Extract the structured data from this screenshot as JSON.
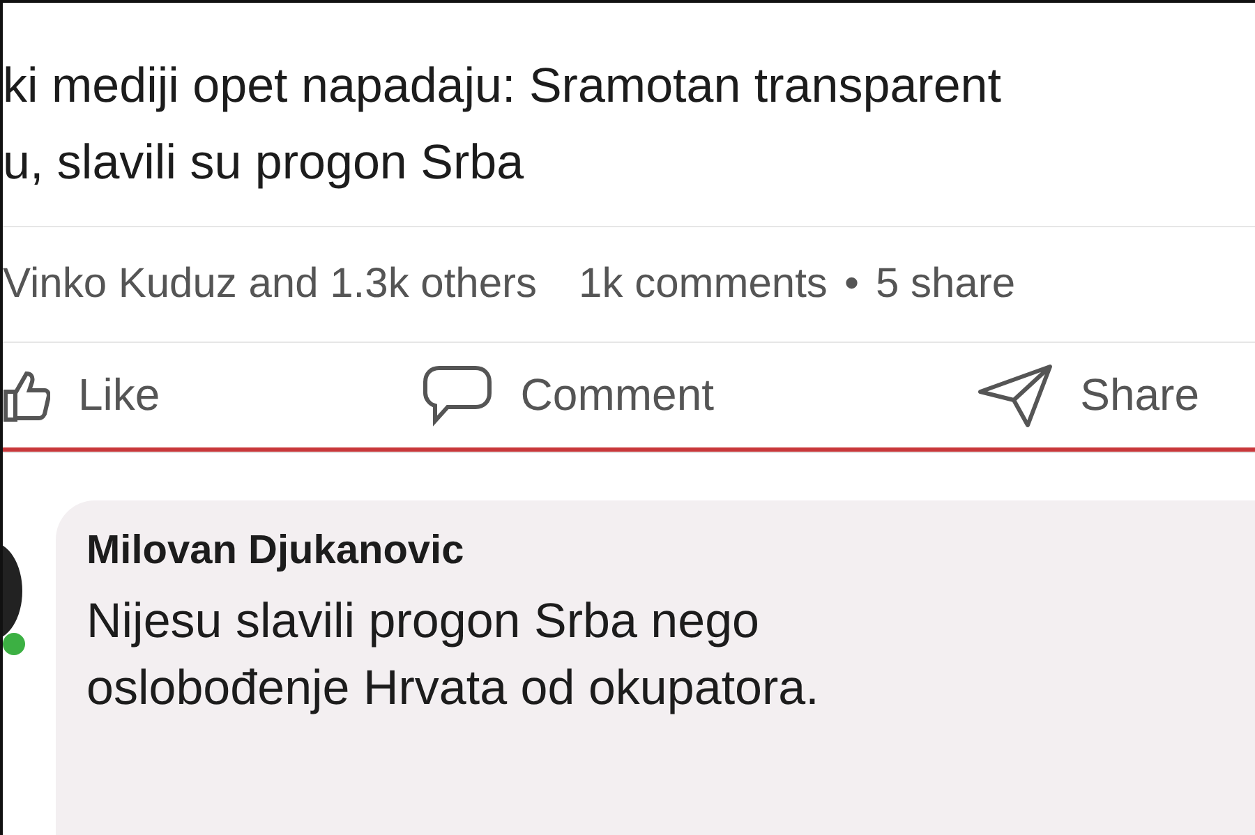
{
  "post": {
    "title_lines": [
      "ki mediji opet napadaju: Sramotan transparent",
      "u, slavili su progon Srba"
    ],
    "reactions": "Vinko Kuduz and 1.3k others",
    "comments": "1k comments",
    "separator": "•",
    "shares": "5 share",
    "actions": [
      {
        "kind": "like",
        "label": "Like"
      },
      {
        "kind": "comment",
        "label": "Comment"
      },
      {
        "kind": "share",
        "label": "Share"
      }
    ]
  },
  "comment": {
    "author": "Milovan Djukanovic",
    "online": true,
    "lines": [
      "Nijesu slavili progon Srba nego",
      "oslobođenje Hrvata od okupatora."
    ]
  }
}
